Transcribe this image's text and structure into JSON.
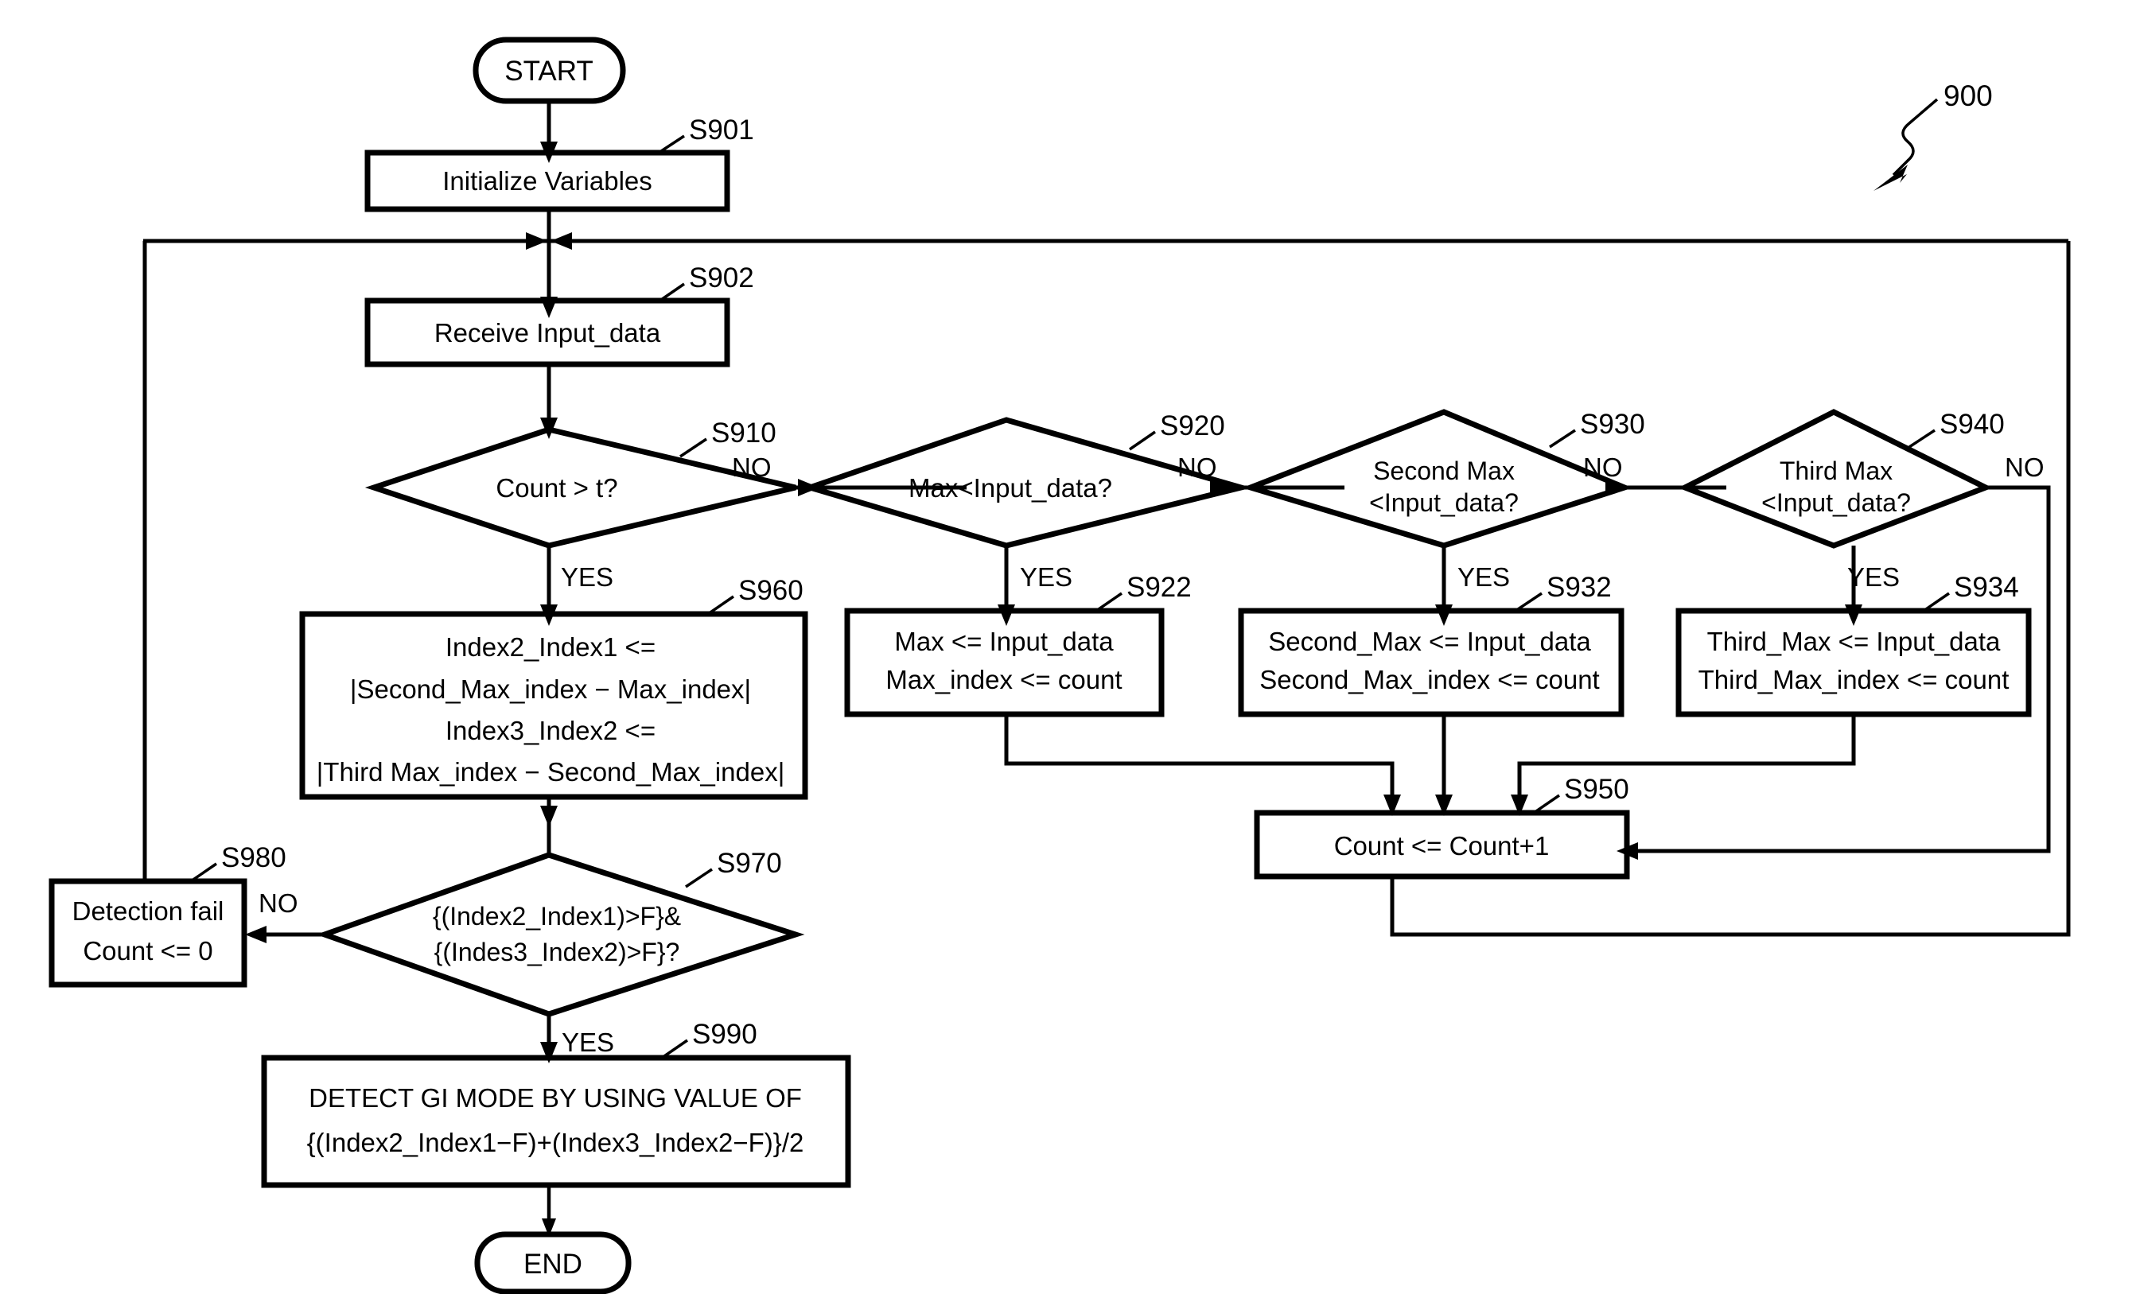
{
  "figure": {
    "number": "900",
    "type": "flowchart"
  },
  "terminators": {
    "start": "START",
    "end": "END"
  },
  "nodes": [
    {
      "id": "S901",
      "ref": "S901",
      "kind": "process",
      "lines": [
        "Initialize Variables"
      ]
    },
    {
      "id": "S902",
      "ref": "S902",
      "kind": "process",
      "lines": [
        "Receive Input_data"
      ]
    },
    {
      "id": "S910",
      "ref": "S910",
      "kind": "decision",
      "lines": [
        "Count > t?"
      ]
    },
    {
      "id": "S920",
      "ref": "S920",
      "kind": "decision",
      "lines": [
        "Max<Input_data?"
      ]
    },
    {
      "id": "S930",
      "ref": "S930",
      "kind": "decision",
      "lines": [
        "Second Max",
        "<Input_data?"
      ]
    },
    {
      "id": "S940",
      "ref": "S940",
      "kind": "decision",
      "lines": [
        "Third Max",
        "<Input_data?"
      ]
    },
    {
      "id": "S922",
      "ref": "S922",
      "kind": "process",
      "lines": [
        "Max <= Input_data",
        "Max_index <= count"
      ]
    },
    {
      "id": "S932",
      "ref": "S932",
      "kind": "process",
      "lines": [
        "Second_Max <= Input_data",
        "Second_Max_index <= count"
      ]
    },
    {
      "id": "S934",
      "ref": "S934",
      "kind": "process",
      "lines": [
        "Third_Max <= Input_data",
        "Third_Max_index <= count"
      ]
    },
    {
      "id": "S950",
      "ref": "S950",
      "kind": "process",
      "lines": [
        "Count <= Count+1"
      ]
    },
    {
      "id": "S960",
      "ref": "S960",
      "kind": "process",
      "lines": [
        "Index2_Index1 <=",
        "|Second_Max_index − Max_index|",
        "Index3_Index2 <=",
        "|Third Max_index − Second_Max_index|"
      ]
    },
    {
      "id": "S970",
      "ref": "S970",
      "kind": "decision",
      "lines": [
        "{(Index2_Index1)>F}&",
        "{(Indes3_Index2)>F}?"
      ]
    },
    {
      "id": "S980",
      "ref": "S980",
      "kind": "process",
      "lines": [
        "Detection fail",
        "Count <= 0"
      ]
    },
    {
      "id": "S990",
      "ref": "S990",
      "kind": "process",
      "lines": [
        "DETECT GI MODE BY USING VALUE OF",
        "{(Index2_Index1−F)+(Index3_Index2−F)}/2"
      ]
    }
  ],
  "edge_labels": {
    "s910_no": "NO",
    "s910_yes": "YES",
    "s920_no": "NO",
    "s920_yes": "YES",
    "s930_no": "NO",
    "s930_yes": "YES",
    "s940_no": "NO",
    "s940_yes": "YES",
    "s970_no": "NO",
    "s970_yes": "YES"
  },
  "refs": {
    "s901": "S901",
    "s902": "S902",
    "s910": "S910",
    "s920": "S920",
    "s922": "S922",
    "s930": "S930",
    "s932": "S932",
    "s934": "S934",
    "s940": "S940",
    "s950": "S950",
    "s960": "S960",
    "s970": "S970",
    "s980": "S980",
    "s990": "S990"
  },
  "node_text": {
    "s901_l1": "Initialize Variables",
    "s902_l1": "Receive Input_data",
    "s910_l1": "Count > t?",
    "s920_l1": "Max<Input_data?",
    "s930_l1": "Second Max",
    "s930_l2": "<Input_data?",
    "s940_l1": "Third Max",
    "s940_l2": "<Input_data?",
    "s922_l1": "Max <= Input_data",
    "s922_l2": "Max_index <= count",
    "s932_l1": "Second_Max <= Input_data",
    "s932_l2": "Second_Max_index <= count",
    "s934_l1": "Third_Max <= Input_data",
    "s934_l2": "Third_Max_index <= count",
    "s950_l1": "Count <= Count+1",
    "s960_l1": "Index2_Index1 <=",
    "s960_l2": "|Second_Max_index − Max_index|",
    "s960_l3": "Index3_Index2 <=",
    "s960_l4": "|Third Max_index − Second_Max_index|",
    "s970_l1": "{(Index2_Index1)>F}&",
    "s970_l2": "{(Indes3_Index2)>F}?",
    "s980_l1": "Detection fail",
    "s980_l2": "Count <= 0",
    "s990_l1": "DETECT GI MODE BY USING VALUE OF",
    "s990_l2": "{(Index2_Index1−F)+(Index3_Index2−F)}/2"
  },
  "colors": {
    "line": "#000000",
    "background": "#ffffff",
    "text": "#000000"
  }
}
